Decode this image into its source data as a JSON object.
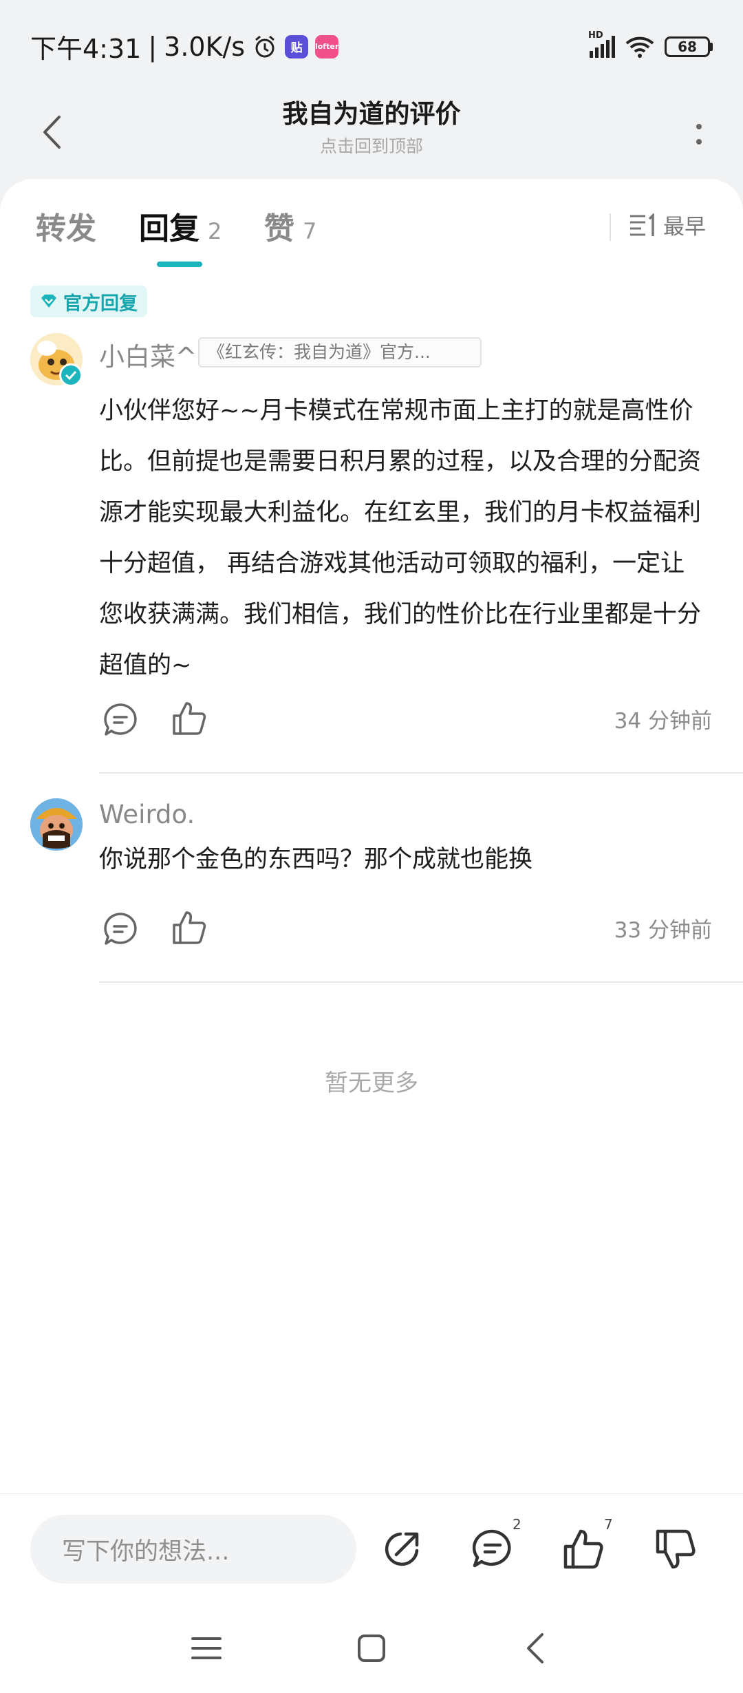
{
  "status_bar": {
    "time": "下午4:31",
    "separator": "|",
    "net_speed": "3.0K/s",
    "app_badge_1": "贴",
    "app_badge_2": "lofter",
    "network_label": "HD",
    "battery": "68"
  },
  "header": {
    "title": "我自为道的评价",
    "subtitle": "点击回到顶部"
  },
  "tabs": [
    {
      "label": "转发",
      "count": ""
    },
    {
      "label": "回复",
      "count": "2",
      "active": true
    },
    {
      "label": "赞",
      "count": "7"
    }
  ],
  "sort": {
    "label": "最早"
  },
  "official_badge": "官方回复",
  "comments": [
    {
      "username": "小白菜^",
      "source_tag": "《红玄传：我自为道》官方...",
      "text": "小伙伴您好~~月卡模式在常规市面上主打的就是高性价比。但前提也是需要日积月累的过程，以及合理的分配资源才能实现最大利益化。在红玄里，我们的月卡权益福利十分超值， 再结合游戏其他活动可领取的福利，一定让您收获满满。我们相信，我们的性价比在行业里都是十分超值的~",
      "time": "34 分钟前"
    },
    {
      "username": "Weirdo.",
      "text": "你说那个金色的东西吗？那个成就也能换",
      "time": "33 分钟前"
    }
  ],
  "no_more": "暂无更多",
  "bottom_bar": {
    "input_placeholder": "写下你的想法...",
    "reply_count": "2",
    "like_count": "7"
  },
  "colors": {
    "accent": "#1ab5bd",
    "background": "#f1f2f4",
    "card": "#ffffff"
  }
}
